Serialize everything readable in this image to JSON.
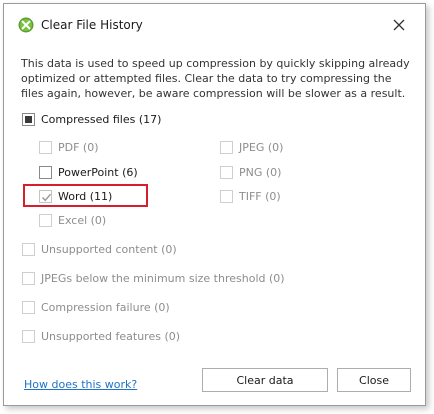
{
  "window": {
    "title": "Clear File History"
  },
  "description": "This data is used to speed up compression by quickly skipping already optimized or attempted files. Clear the data to try compressing the files again, however, be aware compression will be slower as a result.",
  "compressed": {
    "label": "Compressed files (17)"
  },
  "file_types": {
    "pdf": "PDF (0)",
    "powerpoint": "PowerPoint (6)",
    "word": "Word (11)",
    "excel": "Excel (0)",
    "jpeg": "JPEG (0)",
    "png": "PNG (0)",
    "tiff": "TIFF (0)"
  },
  "categories": {
    "unsupported_content": "Unsupported content (0)",
    "jpegs_below": "JPEGs below the minimum size threshold (0)",
    "compression_failure": "Compression failure (0)",
    "unsupported_features": "Unsupported features (0)"
  },
  "footer": {
    "help_link": "How does this work?",
    "clear_button": "Clear data",
    "close_button": "Close"
  },
  "colors": {
    "highlight": "#d71e2b",
    "link": "#1f73c6",
    "app_icon": "#5aa02c"
  }
}
